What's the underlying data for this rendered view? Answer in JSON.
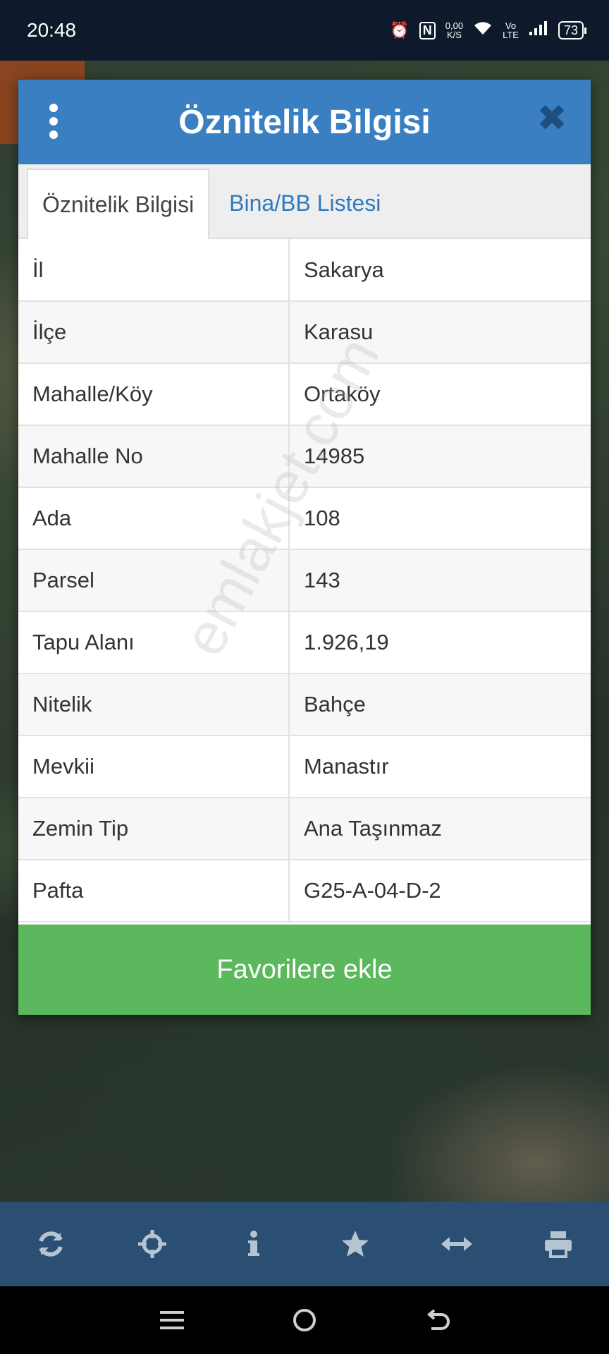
{
  "status_bar": {
    "time": "20:48",
    "net_speed_top": "0,00",
    "net_speed_bottom": "K/S",
    "volte_top": "Vo",
    "volte_bottom": "LTE",
    "battery": "73"
  },
  "dialog": {
    "title": "Öznitelik Bilgisi",
    "close_symbol": "✖",
    "tabs": [
      {
        "label": "Öznitelik Bilgisi",
        "active": true
      },
      {
        "label": "Bina/BB Listesi",
        "active": false
      }
    ],
    "rows": [
      {
        "key": "İl",
        "value": "Sakarya"
      },
      {
        "key": "İlçe",
        "value": "Karasu"
      },
      {
        "key": "Mahalle/Köy",
        "value": "Ortaköy"
      },
      {
        "key": "Mahalle No",
        "value": "14985"
      },
      {
        "key": "Ada",
        "value": "108"
      },
      {
        "key": "Parsel",
        "value": "143"
      },
      {
        "key": "Tapu Alanı",
        "value": "1.926,19"
      },
      {
        "key": "Nitelik",
        "value": "Bahçe"
      },
      {
        "key": "Mevkii",
        "value": "Manastır"
      },
      {
        "key": "Zemin Tip",
        "value": "Ana Taşınmaz"
      },
      {
        "key": "Pafta",
        "value": "G25-A-04-D-2"
      }
    ],
    "favorite_label": "Favorilere ekle"
  },
  "watermark": "emlakjet.com",
  "toolbar": {
    "icons": [
      "refresh-icon",
      "crosshair-icon",
      "info-icon",
      "star-icon",
      "arrows-horizontal-icon",
      "printer-icon"
    ]
  },
  "colors": {
    "header": "#3a7fc1",
    "tab_inactive_text": "#2f7abf",
    "favorite_button": "#5cb85c",
    "toolbar": "#2a4f72"
  }
}
